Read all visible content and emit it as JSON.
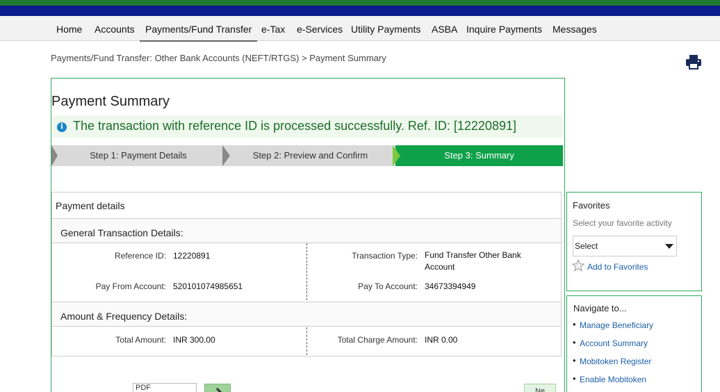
{
  "nav": {
    "items": [
      {
        "label": "Home",
        "active": false
      },
      {
        "label": "Accounts",
        "active": false
      },
      {
        "label": "Payments/Fund Transfer",
        "active": true
      },
      {
        "label": "e-Tax",
        "active": false
      },
      {
        "label": "e-Services",
        "active": false
      },
      {
        "label": "Utility Payments",
        "active": false
      },
      {
        "label": "ASBA",
        "active": false
      },
      {
        "label": "Inquire Payments",
        "active": false
      },
      {
        "label": "Messages",
        "active": false
      }
    ]
  },
  "breadcrumb": "Payments/Fund Transfer: Other Bank Accounts (NEFT/RTGS) > Payment Summary",
  "print_icon": "printer-icon",
  "page_title": "Payment Summary",
  "banner": {
    "icon": "info-icon",
    "icon_glyph": "i",
    "text": "The transaction with reference ID is processed successfully. Ref. ID: [12220891]"
  },
  "steps": [
    {
      "label": "Step 1: Payment Details",
      "state": "done"
    },
    {
      "label": "Step 2: Preview and Confirm",
      "state": "done"
    },
    {
      "label": "Step 3: Summary",
      "state": "current"
    }
  ],
  "details": {
    "title": "Payment details",
    "general": {
      "title": "General Transaction Details:",
      "reference_id_label": "Reference ID:",
      "reference_id_value": "12220891",
      "transaction_type_label": "Transaction Type:",
      "transaction_type_value": "Fund Transfer Other Bank Account",
      "pay_from_label": "Pay From Account:",
      "pay_from_value": "520101074985651",
      "pay_to_label": "Pay To Account:",
      "pay_to_value": "34673394949"
    },
    "amount": {
      "title": "Amount & Frequency Details:",
      "total_amount_label": "Total Amount:",
      "total_amount_value": "INR 300.00",
      "total_charge_label": "Total Charge Amount:",
      "total_charge_value": "INR 0.00"
    }
  },
  "favorites": {
    "title": "Favorites",
    "hint": "Select your favorite activity",
    "select_value": "Select",
    "add_link": "Add to Favorites",
    "star_icon": "star-icon"
  },
  "navigate": {
    "title": "Navigate to...",
    "links": [
      "Manage Beneficiary",
      "Account Summary",
      "Mobitoken Register",
      "Enable Mobitoken"
    ]
  },
  "bottom": {
    "input_value": "PDF",
    "next_label": "Ne"
  },
  "colors": {
    "brand_green": "#1f7a33",
    "brand_blue": "#0b1d8c",
    "step_active": "#0fa14a",
    "success_text": "#1d6b2b",
    "link": "#1a5fa8"
  }
}
